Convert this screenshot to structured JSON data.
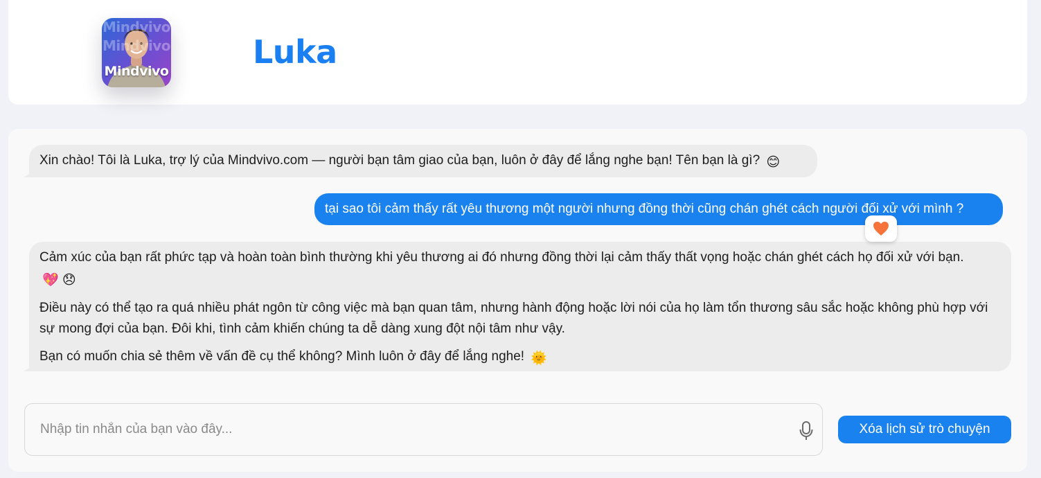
{
  "header": {
    "avatar_watermark": "Mindvivo",
    "avatar_brand": "Mindvivo",
    "assistant_name": "Luka"
  },
  "messages": [
    {
      "role": "assistant",
      "text": "Xin chào! Tôi là Luka, trợ lý của Mindvivo.com — người bạn tâm giao của bạn, luôn ở đây để lắng nghe bạn! Tên bạn là gì?",
      "emoji": "😊"
    },
    {
      "role": "user",
      "text": "tại sao tôi cảm thấy rất yêu thương một người nhưng đồng thời cũng chán ghét cách người đối xử với mình ?",
      "reaction": "🧡"
    },
    {
      "role": "assistant",
      "paragraphs": [
        {
          "text": "Cảm xúc của bạn rất phức tạp và hoàn toàn bình thường khi yêu thương ai đó nhưng đồng thời lại cảm thấy thất vọng hoặc chán ghét cách họ đối xử với bạn.",
          "emoji": "💖 😞"
        },
        {
          "text": "Điều này có thể tạo ra quá nhiều phát ngôn từ công việc mà bạn quan tâm, nhưng hành động hoặc lời nói của họ làm tổn thương sâu sắc hoặc không phù hợp với sự mong đợi của bạn. Đôi khi, tình cảm khiến chúng ta dễ dàng xung đột nội tâm như vậy.",
          "emoji": ""
        },
        {
          "text": "Bạn có muốn chia sẻ thêm về vấn đề cụ thể không? Mình luôn ở đây để lắng nghe!",
          "emoji": "🌞"
        }
      ]
    }
  ],
  "composer": {
    "placeholder": "Nhập tin nhắn của bạn vào đây...",
    "value": "",
    "mic_icon": "microphone-icon",
    "clear_button": "Xóa lịch sử trò chuyện"
  },
  "colors": {
    "accent": "#1a82ee",
    "title": "#1a7ff0",
    "bot_bubble": "#ececec",
    "page_bg": "#f0f2f7"
  }
}
